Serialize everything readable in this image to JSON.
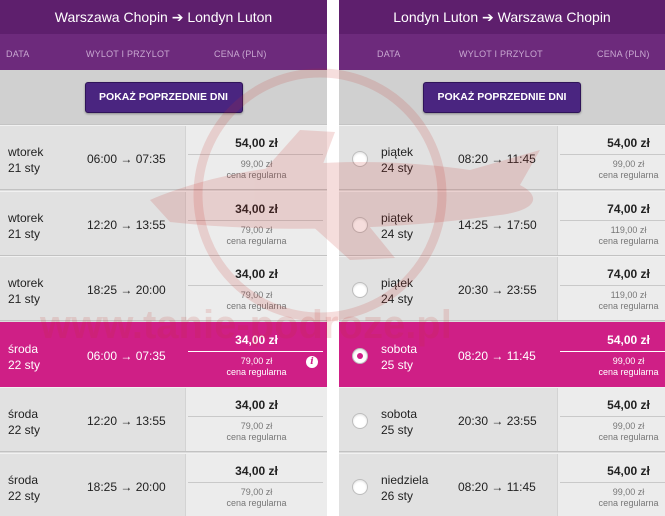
{
  "outbound": {
    "title": "Warszawa Chopin ➔ Londyn Luton",
    "col_date": "DATA",
    "col_route": "WYLOT I PRZYLOT",
    "col_price": "CENA (PLN)",
    "prev_button": "POKAŻ POPRZEDNIE DNI",
    "flights": [
      {
        "weekday": "wtorek",
        "date": "21 sty",
        "times": "06:00 → 07:35",
        "price": "54,00 zł",
        "regular_price": "99,00 zł",
        "regular_label": "cena regularna"
      },
      {
        "weekday": "wtorek",
        "date": "21 sty",
        "times": "12:20 → 13:55",
        "price": "34,00 zł",
        "regular_price": "79,00 zł",
        "regular_label": "cena regularna"
      },
      {
        "weekday": "wtorek",
        "date": "21 sty",
        "times": "18:25 → 20:00",
        "price": "34,00 zł",
        "regular_price": "79,00 zł",
        "regular_label": "cena regularna"
      },
      {
        "weekday": "środa",
        "date": "22 sty",
        "times": "06:00 → 07:35",
        "price": "34,00 zł",
        "regular_price": "79,00 zł",
        "regular_label": "cena regularna",
        "selected": true,
        "info_icon": "info-icon"
      },
      {
        "weekday": "środa",
        "date": "22 sty",
        "times": "12:20 → 13:55",
        "price": "34,00 zł",
        "regular_price": "79,00 zł",
        "regular_label": "cena regularna"
      },
      {
        "weekday": "środa",
        "date": "22 sty",
        "times": "18:25 → 20:00",
        "price": "34,00 zł",
        "regular_price": "79,00 zł",
        "regular_label": "cena regularna"
      }
    ]
  },
  "inbound": {
    "title": "Londyn Luton ➔ Warszawa Chopin",
    "col_date": "DATA",
    "col_route": "WYLOT I PRZYLOT",
    "col_price": "CENA (PLN)",
    "prev_button": "POKAŻ POPRZEDNIE DNI",
    "flights": [
      {
        "weekday": "piątek",
        "date": "24 sty",
        "times": "08:20 → 11:45",
        "price": "54,00 zł",
        "regular_price": "99,00 zł",
        "regular_label": "cena regularna"
      },
      {
        "weekday": "piątek",
        "date": "24 sty",
        "times": "14:25 → 17:50",
        "price": "74,00 zł",
        "regular_price": "119,00 zł",
        "regular_label": "cena regularna"
      },
      {
        "weekday": "piątek",
        "date": "24 sty",
        "times": "20:30 → 23:55",
        "price": "74,00 zł",
        "regular_price": "119,00 zł",
        "regular_label": "cena regularna"
      },
      {
        "weekday": "sobota",
        "date": "25 sty",
        "times": "08:20 → 11:45",
        "price": "54,00 zł",
        "regular_price": "99,00 zł",
        "regular_label": "cena regularna",
        "selected": true
      },
      {
        "weekday": "sobota",
        "date": "25 sty",
        "times": "20:30 → 23:55",
        "price": "54,00 zł",
        "regular_price": "99,00 zł",
        "regular_label": "cena regularna"
      },
      {
        "weekday": "niedziela",
        "date": "26 sty",
        "times": "08:20 → 11:45",
        "price": "54,00 zł",
        "regular_price": "99,00 zł",
        "regular_label": "cena regularna"
      }
    ]
  },
  "watermark": {
    "text": "www.tanie-podroze.pl",
    "color": "#c8322b"
  },
  "colors": {
    "header": "#5e1f6d",
    "subheader": "#6d2a7c",
    "selected_row": "#cf1f86",
    "button": "#4a2580"
  },
  "info_glyph": "i"
}
